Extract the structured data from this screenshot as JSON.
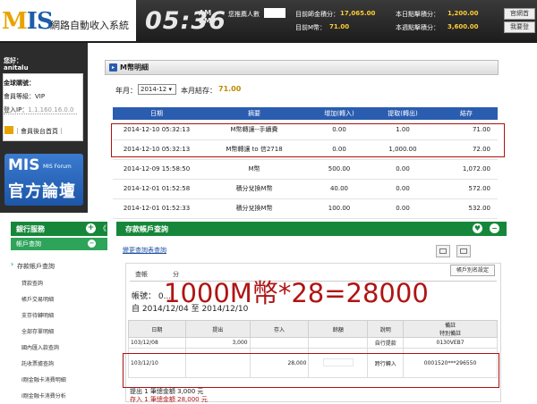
{
  "header": {
    "logo_letters": "MIS",
    "logo_subtitle": "網路自動收入系統",
    "clock": "05:36",
    "clock_am": "AM",
    "clock_pm": "PM",
    "online_label": "您推薦人數",
    "site_points_label": "目前師金積分：",
    "site_points_value": "17,065.00",
    "m_coin_label": "目前M幣：",
    "m_coin_value": "71.00",
    "today_points_label": "本日點擊積分：",
    "today_points_value": "1,200.00",
    "week_points_label": "本週點擊積分：",
    "week_points_value": "3,600.00",
    "btn_home": "官網首",
    "btn_member": "我要登"
  },
  "sidebar": {
    "greeting": "您好：",
    "username": "anitalu",
    "company_label": "金球購號：",
    "level_label": "會員等級：VIP",
    "login_ip_label": "登入IP：",
    "login_ip_value": "1.1.160.16.0.0",
    "home_link": "｜會員後台首頁｜",
    "forum_mis": "MIS",
    "forum_small": "MIS Forum",
    "forum_big": "官方論壇"
  },
  "m_detail": {
    "title": "M幣明細",
    "year_label": "年月：",
    "year_value": "2014-12 ▾",
    "balance_label": "本月結存：",
    "balance_value": "71.00",
    "headers": [
      "日期",
      "摘要",
      "增加(轉入)",
      "提取(轉出)",
      "結存"
    ],
    "rows": [
      [
        "2014-12-10 05:32:13",
        "M幣轉讓--手續費",
        "0.00",
        "1.00",
        "71.00"
      ],
      [
        "2014-12-10 05:32:13",
        "M幣轉讓 to 信2718",
        "0.00",
        "1,000.00",
        "72.00"
      ],
      [
        "2014-12-09 15:58:50",
        "M幣",
        "500.00",
        "0.00",
        "1,072.00"
      ],
      [
        "2014-12-01 01:52:58",
        "積分兌換M幣",
        "40.00",
        "0.00",
        "572.00"
      ],
      [
        "2014-12-01 01:52:33",
        "積分兌換M幣",
        "100.00",
        "0.00",
        "532.00"
      ]
    ]
  },
  "bank_sidebar": {
    "title": "銀行服務",
    "collapse": "《",
    "section": "帳戶查詢",
    "items": [
      "存款帳戶查詢",
      "貸款查詢",
      "帳戶交易明細",
      "支存待轉明細",
      "全部存單明細",
      "國內匯入款查詢",
      "託收票據查詢",
      "Ⅰ剛金融卡消費明細",
      "Ⅰ剛金融卡消費分析"
    ]
  },
  "deposit": {
    "title": "存款帳戶查詢",
    "link": "變更查詢表查詢",
    "tab1": "查帳",
    "tab2": "分",
    "nick_btn": "帳戶別名設定",
    "account_line": "帳號：  0...",
    "range_line": "自 2014/12/04 至 2014/12/10",
    "big_note": "1000M幣*28=28000",
    "headers": [
      "日期",
      "提出",
      "存入",
      "餘額",
      "說明",
      "備註\n特別備註"
    ],
    "rows": [
      [
        "103/12/08",
        "3,000",
        "",
        "",
        "自行提款",
        "0130VEB7"
      ],
      [
        "103/12/10",
        "",
        "28,000",
        "",
        "跨行轉入",
        "0001520***296550"
      ]
    ],
    "sum_out": "提出 1 筆總金額 3,000 元",
    "sum_in": "存入 1 筆總金額 28,000 元"
  }
}
